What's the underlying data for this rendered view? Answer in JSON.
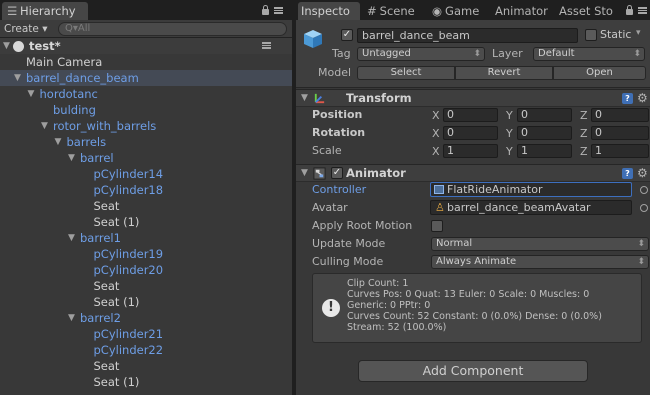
{
  "hierarchy": {
    "tab_label": "Hierarchy",
    "create_label": "Create ▾",
    "search_placeholder": "Q▾All",
    "scene_name": "test*",
    "rows": [
      {
        "label": "Main Camera",
        "indent": 0,
        "arrow": "",
        "color": "white",
        "selected": false
      },
      {
        "label": "barrel_dance_beam",
        "indent": 0,
        "arrow": "▼",
        "color": "blue",
        "selected": true
      },
      {
        "label": "hordotanc",
        "indent": 1,
        "arrow": "▼",
        "color": "blue",
        "selected": false
      },
      {
        "label": "bulding",
        "indent": 2,
        "arrow": "",
        "color": "blue",
        "selected": false
      },
      {
        "label": "rotor_with_barrels",
        "indent": 2,
        "arrow": "▼",
        "color": "blue",
        "selected": false
      },
      {
        "label": "barrels",
        "indent": 3,
        "arrow": "▼",
        "color": "blue",
        "selected": false
      },
      {
        "label": "barrel",
        "indent": 4,
        "arrow": "▼",
        "color": "blue",
        "selected": false
      },
      {
        "label": "pCylinder14",
        "indent": 5,
        "arrow": "",
        "color": "blue",
        "selected": false
      },
      {
        "label": "pCylinder18",
        "indent": 5,
        "arrow": "",
        "color": "blue",
        "selected": false
      },
      {
        "label": "Seat",
        "indent": 5,
        "arrow": "",
        "color": "white",
        "selected": false
      },
      {
        "label": "Seat (1)",
        "indent": 5,
        "arrow": "",
        "color": "white",
        "selected": false
      },
      {
        "label": "barrel1",
        "indent": 4,
        "arrow": "▼",
        "color": "blue",
        "selected": false
      },
      {
        "label": "pCylinder19",
        "indent": 5,
        "arrow": "",
        "color": "blue",
        "selected": false
      },
      {
        "label": "pCylinder20",
        "indent": 5,
        "arrow": "",
        "color": "blue",
        "selected": false
      },
      {
        "label": "Seat",
        "indent": 5,
        "arrow": "",
        "color": "white",
        "selected": false
      },
      {
        "label": "Seat (1)",
        "indent": 5,
        "arrow": "",
        "color": "white",
        "selected": false
      },
      {
        "label": "barrel2",
        "indent": 4,
        "arrow": "▼",
        "color": "blue",
        "selected": false
      },
      {
        "label": "pCylinder21",
        "indent": 5,
        "arrow": "",
        "color": "blue",
        "selected": false
      },
      {
        "label": "pCylinder22",
        "indent": 5,
        "arrow": "",
        "color": "blue",
        "selected": false
      },
      {
        "label": "Seat",
        "indent": 5,
        "arrow": "",
        "color": "white",
        "selected": false
      },
      {
        "label": "Seat (1)",
        "indent": 5,
        "arrow": "",
        "color": "white",
        "selected": false
      }
    ]
  },
  "tabs": [
    {
      "label": "Inspecto",
      "icon": "",
      "active": true
    },
    {
      "label": "Scene",
      "icon": "#",
      "active": false
    },
    {
      "label": "Game",
      "icon": "◉",
      "active": false
    },
    {
      "label": "Animator",
      "icon": "",
      "active": false
    },
    {
      "label": "Asset Sto",
      "icon": "",
      "active": false
    }
  ],
  "inspector": {
    "object_name": "barrel_dance_beam",
    "active_checked": true,
    "static_label": "Static",
    "tag_label": "Tag",
    "tag_value": "Untagged",
    "layer_label": "Layer",
    "layer_value": "Default",
    "model_label": "Model",
    "model_buttons": [
      "Select",
      "Revert",
      "Open"
    ]
  },
  "transform": {
    "title": "Transform",
    "rows": [
      {
        "label": "Position",
        "bold": true,
        "x": "0",
        "y": "0",
        "z": "0"
      },
      {
        "label": "Rotation",
        "bold": true,
        "x": "0",
        "y": "0",
        "z": "0"
      },
      {
        "label": "Scale",
        "bold": false,
        "x": "1",
        "y": "1",
        "z": "1"
      }
    ],
    "axes": [
      "X",
      "Y",
      "Z"
    ]
  },
  "animator": {
    "title": "Animator",
    "enabled": true,
    "controller_label": "Controller",
    "controller_value": "FlatRideAnimator",
    "avatar_label": "Avatar",
    "avatar_value": "barrel_dance_beamAvatar",
    "apply_root_motion_label": "Apply Root Motion",
    "apply_root_motion": false,
    "update_mode_label": "Update Mode",
    "update_mode_value": "Normal",
    "culling_mode_label": "Culling Mode",
    "culling_mode_value": "Always Animate",
    "info_lines": [
      "Clip Count: 1",
      "Curves Pos: 0 Quat: 13 Euler: 0 Scale: 0 Muscles: 0",
      "Generic: 0 PPtr: 0",
      "Curves Count: 52 Constant: 0 (0.0%) Dense: 0 (0.0%)",
      "Stream: 52 (100.0%)"
    ]
  },
  "add_component_label": "Add Component",
  "colors": {
    "panel_bg": "#383838",
    "tab_bar_bg": "#1f1f1f",
    "prefab_blue": "#6e9ee6",
    "selection": "#444a55",
    "focus_blue": "#3d6fbf"
  }
}
